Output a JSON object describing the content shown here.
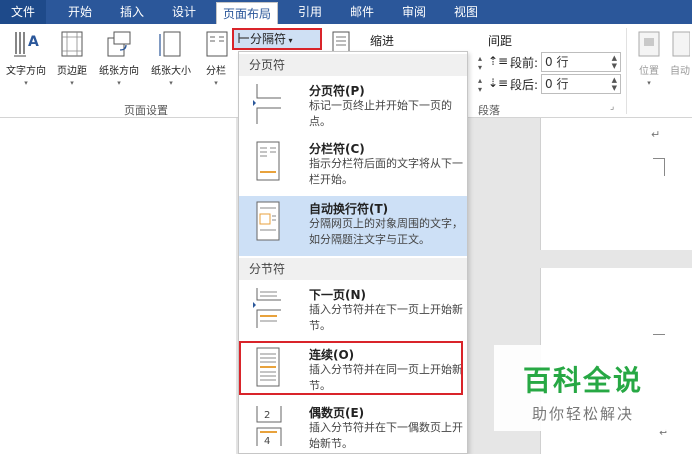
{
  "tabs": [
    {
      "label": "文件"
    },
    {
      "label": "开始"
    },
    {
      "label": "插入"
    },
    {
      "label": "设计"
    },
    {
      "label": "页面布局"
    },
    {
      "label": "引用"
    },
    {
      "label": "邮件"
    },
    {
      "label": "审阅"
    },
    {
      "label": "视图"
    }
  ],
  "ribbon": {
    "page_setup": {
      "buttons": [
        {
          "label": "文字方向"
        },
        {
          "label": "页边距"
        },
        {
          "label": "纸张方向"
        },
        {
          "label": "纸张大小"
        },
        {
          "label": "分栏"
        }
      ],
      "group_label": "页面设置"
    },
    "breaks_button": "分隔符",
    "indent_label": "缩进",
    "spacing_label": "间距",
    "before_label": "段前:",
    "before_value": "0 行",
    "after_label": "段后:",
    "after_value": "0 行",
    "paragraph_group_label": "段落",
    "position_label": "位置",
    "autowrap_label": "自动"
  },
  "breaks_menu": {
    "page_breaks_header": "分页符",
    "section_breaks_header": "分节符",
    "items": [
      {
        "title": "分页符(P)",
        "desc": "标记一页终止并开始下一页的点。"
      },
      {
        "title": "分栏符(C)",
        "desc": "指示分栏符后面的文字将从下一栏开始。"
      },
      {
        "title": "自动换行符(T)",
        "desc": "分隔网页上的对象周围的文字，如分隔题注文字与正文。"
      },
      {
        "title": "下一页(N)",
        "desc": "插入分节符并在下一页上开始新节。"
      },
      {
        "title": "连续(O)",
        "desc": "插入分节符并在同一页上开始新节。"
      },
      {
        "title": "偶数页(E)",
        "desc": "插入分节符并在下一偶数页上开始新节。"
      }
    ]
  },
  "watermark": {
    "title": "百科全说",
    "subtitle": "助你轻松解决"
  },
  "colors": {
    "tab_bar": "#2b579a",
    "highlight_box": "#d9242a",
    "menu_hover": "#cde0f6",
    "watermark_green": "#27a844"
  }
}
